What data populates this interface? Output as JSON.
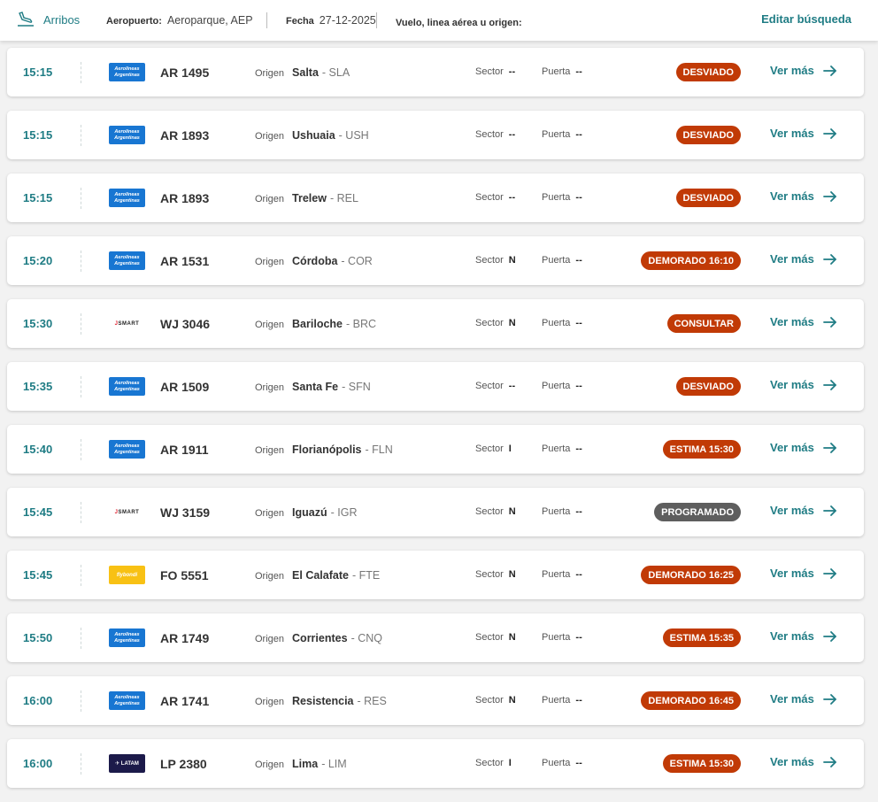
{
  "header": {
    "arrivals_label": "Arribos",
    "airport_label": "Aeropuerto:",
    "airport_value": "Aeroparque, AEP",
    "date_label": "Fecha",
    "date_value": "27-12-2025",
    "search_label": "Vuelo, linea aérea u origen:",
    "edit_label": "Editar búsqueda"
  },
  "labels": {
    "origin": "Origen",
    "sector": "Sector",
    "gate": "Puerta",
    "more": "Ver más"
  },
  "colors": {
    "accent": "#1f7c84",
    "status_alert": "#c13a06",
    "status_neutral": "#5e5e5e"
  },
  "flights": [
    {
      "time": "15:15",
      "airline": "aerolineas-argentinas",
      "flight": "AR 1495",
      "city": "Salta",
      "code": "- SLA",
      "sector": "--",
      "gate": "--",
      "status": "DESVIADO"
    },
    {
      "time": "15:15",
      "airline": "aerolineas-argentinas",
      "flight": "AR 1893",
      "city": "Ushuaia",
      "code": "- USH",
      "sector": "--",
      "gate": "--",
      "status": "DESVIADO"
    },
    {
      "time": "15:15",
      "airline": "aerolineas-argentinas",
      "flight": "AR 1893",
      "city": "Trelew",
      "code": "- REL",
      "sector": "--",
      "gate": "--",
      "status": "DESVIADO"
    },
    {
      "time": "15:20",
      "airline": "aerolineas-argentinas",
      "flight": "AR 1531",
      "city": "Córdoba",
      "code": "- COR",
      "sector": "N",
      "gate": "--",
      "status": "DEMORADO 16:10"
    },
    {
      "time": "15:30",
      "airline": "jetsmart",
      "flight": "WJ 3046",
      "city": "Bariloche",
      "code": "- BRC",
      "sector": "N",
      "gate": "--",
      "status": "CONSULTAR"
    },
    {
      "time": "15:35",
      "airline": "aerolineas-argentinas",
      "flight": "AR 1509",
      "city": "Santa Fe",
      "code": "- SFN",
      "sector": "--",
      "gate": "--",
      "status": "DESVIADO"
    },
    {
      "time": "15:40",
      "airline": "aerolineas-argentinas",
      "flight": "AR 1911",
      "city": "Florianópolis",
      "code": "- FLN",
      "sector": "I",
      "gate": "--",
      "status": "ESTIMA 15:30"
    },
    {
      "time": "15:45",
      "airline": "jetsmart",
      "flight": "WJ 3159",
      "city": "Iguazú",
      "code": "- IGR",
      "sector": "N",
      "gate": "--",
      "status": "PROGRAMADO",
      "status_style": "grey"
    },
    {
      "time": "15:45",
      "airline": "flybondi",
      "flight": "FO 5551",
      "city": "El Calafate",
      "code": "- FTE",
      "sector": "N",
      "gate": "--",
      "status": "DEMORADO 16:25"
    },
    {
      "time": "15:50",
      "airline": "aerolineas-argentinas",
      "flight": "AR 1749",
      "city": "Corrientes",
      "code": "- CNQ",
      "sector": "N",
      "gate": "--",
      "status": "ESTIMA 15:35"
    },
    {
      "time": "16:00",
      "airline": "aerolineas-argentinas",
      "flight": "AR 1741",
      "city": "Resistencia",
      "code": "- RES",
      "sector": "N",
      "gate": "--",
      "status": "DEMORADO 16:45"
    },
    {
      "time": "16:00",
      "airline": "latam",
      "flight": "LP 2380",
      "city": "Lima",
      "code": "- LIM",
      "sector": "I",
      "gate": "--",
      "status": "ESTIMA 15:30"
    }
  ]
}
